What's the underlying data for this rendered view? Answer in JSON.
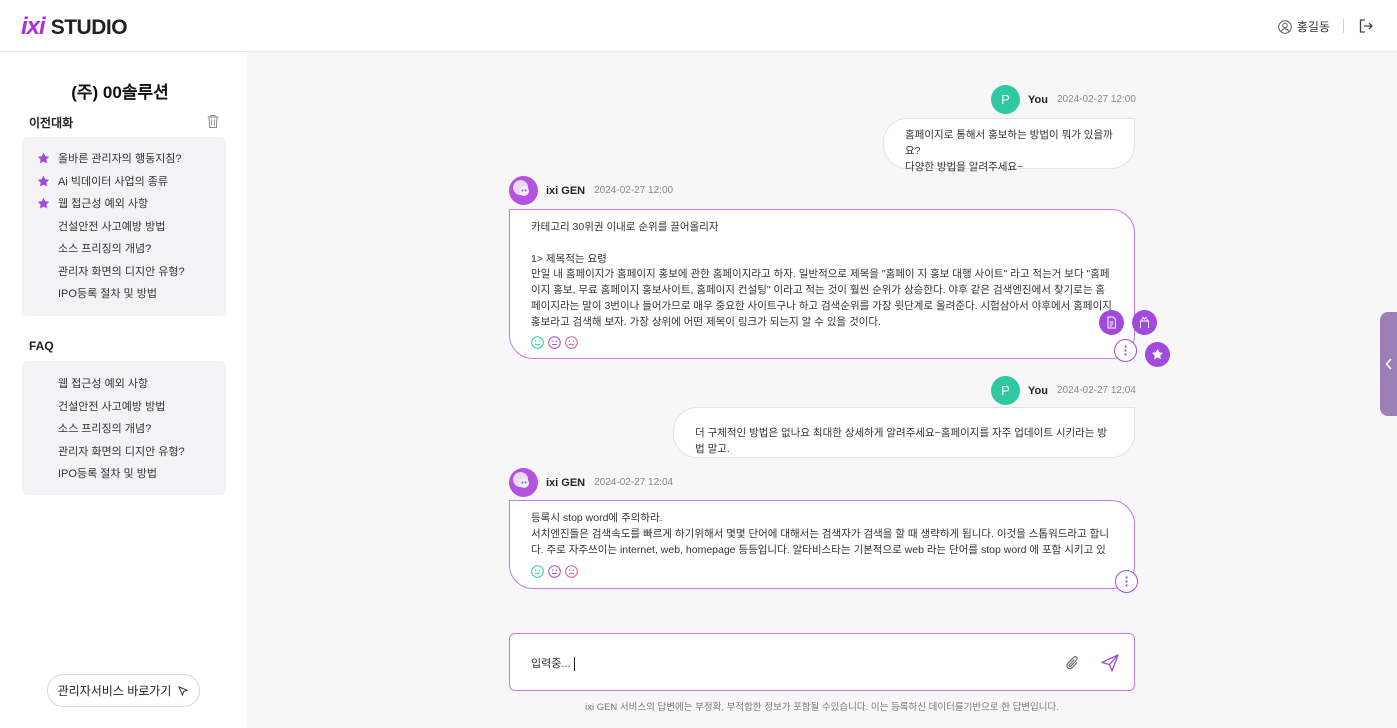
{
  "header": {
    "logo_ixi": "ixi",
    "logo_studio": "STUDIO",
    "user_name": "홍길동",
    "icons": [
      "user-icon",
      "logout-icon"
    ]
  },
  "sidebar": {
    "company": "(주) 00솔루션",
    "history_title": "이전대화",
    "history": [
      {
        "label": "올바른 관리자의 행동지침?",
        "starred": true
      },
      {
        "label": "Ai 빅데이터 사업의 종류",
        "starred": true
      },
      {
        "label": "웹 접근성 예외 사항",
        "starred": true
      },
      {
        "label": "건설안전 사고예방 방법",
        "starred": false
      },
      {
        "label": "소스 프리징의 개념?",
        "starred": false
      },
      {
        "label": "관리자 화면의 디지안 유형?",
        "starred": false
      },
      {
        "label": "IPO등록 절차 및 방법",
        "starred": false
      }
    ],
    "faq_title": "FAQ",
    "faq": [
      {
        "label": "웹 접근성 예외 사항"
      },
      {
        "label": "건설안전 사고예방 방법"
      },
      {
        "label": "소스 프리징의 개념?"
      },
      {
        "label": "관리자 화면의 디지안 유형?"
      },
      {
        "label": "IPO등록 절차 및 방법"
      }
    ],
    "admin_button": "관리자서비스 바로가기"
  },
  "chat": {
    "messages": [
      {
        "role": "user",
        "avatar": "P",
        "name": "You",
        "time": "2024-02-27 12:00",
        "text": "홈페이지로 통해서 홍보하는 방법이 뭐가 있을까요?\n다양한 방법을 알려주세요~"
      },
      {
        "role": "ai",
        "name": "ixi GEN",
        "time": "2024-02-27 12:00",
        "text": "카테고리 30위권 이내로 순위를 끌어올리자\n\n1> 제목적는 요령\n만일 내 홈페이지가 홈페이지 홍보에 관한 홈페이지라고 하자. 일반적으로 제목을 \"홈페이 지 홍보 대행 사이트\" 라고 적는거 보다 \"홈페이지 홍보, 무료 홈페이지 홍보사이트, 홈페이지 컨설팅\" 이라고 적는 것이 훨씬 순위가 상승한다. 야후 같은 검색엔진에서 찾기로는 홈페이지라는 말이 3번이나 들어가므로 매우 중요한 사이트구나 하고 검색순위를 가장 윗단계로 올려준다. 시험삼아서 야후에서 홈페이지 홍보라고 검색해 보자. 가장 상위에 어떤 제목이 링크가 되는지 알 수 있을 것이다."
      },
      {
        "role": "user",
        "avatar": "P",
        "name": "You",
        "time": "2024-02-27 12:04",
        "text": "더 구체적인 방법은 없나요 최대한 상세하게 알려주세요~홈페이지를 자주 업데이트 시키라는 방법 말고."
      },
      {
        "role": "ai",
        "name": "ixi GEN",
        "time": "2024-02-27 12:04",
        "text": "등록시 stop word에 주의하라.\n서치엔진들은 검색속도를 빠르게 하기위해서 몇몇 단어에 대해서는 검색자가 검색을 할 때 생략하게 됩니다. 이것을 스톱워드라고 합니다. 주로 자주쓰이는 internet, web, homepage 등등입니다. 알타비스타는 기본적으로 web 라는 단어를 stop word 에 포함 시키고 있는데 어떤 검색"
      }
    ],
    "reaction_icons": [
      "smile-icon",
      "neutral-icon",
      "frown-icon"
    ]
  },
  "input": {
    "value": "입력중...",
    "icons": [
      "attach-icon",
      "send-icon"
    ]
  },
  "disclaimer": "ixi GEN 서비스의 답변에는 부정확, 부적합한 정보가 포함될 수있습니다. 이는 등록하신 데이터를기반으로 한 답변입니다.",
  "colors": {
    "brand": "#b12fd8",
    "accent": "#a14ade",
    "user_avatar": "#2ec9a0",
    "ai_border": "#c879e8"
  }
}
